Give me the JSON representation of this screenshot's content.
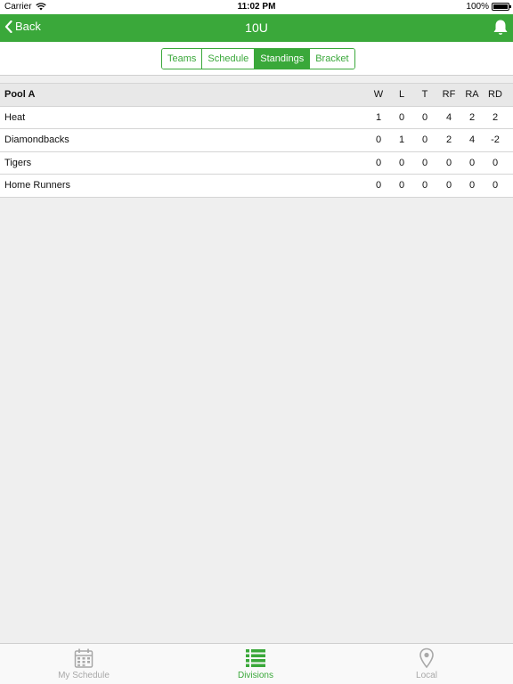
{
  "status": {
    "carrier": "Carrier",
    "time": "11:02 PM",
    "battery": "100%"
  },
  "nav": {
    "back_label": "Back",
    "title": "10U"
  },
  "segments": [
    {
      "label": "Teams",
      "active": false
    },
    {
      "label": "Schedule",
      "active": false
    },
    {
      "label": "Standings",
      "active": true
    },
    {
      "label": "Bracket",
      "active": false
    }
  ],
  "standings": {
    "pool_label": "Pool A",
    "columns": [
      "W",
      "L",
      "T",
      "RF",
      "RA",
      "RD"
    ],
    "rows": [
      {
        "team": "Heat",
        "stats": [
          "1",
          "0",
          "0",
          "4",
          "2",
          "2"
        ]
      },
      {
        "team": "Diamondbacks",
        "stats": [
          "0",
          "1",
          "0",
          "2",
          "4",
          "-2"
        ]
      },
      {
        "team": "Tigers",
        "stats": [
          "0",
          "0",
          "0",
          "0",
          "0",
          "0"
        ]
      },
      {
        "team": "Home Runners",
        "stats": [
          "0",
          "0",
          "0",
          "0",
          "0",
          "0"
        ]
      }
    ]
  },
  "tabs": [
    {
      "label": "My Schedule",
      "icon": "calendar-icon",
      "active": false
    },
    {
      "label": "Divisions",
      "icon": "list-icon",
      "active": true
    },
    {
      "label": "Local",
      "icon": "location-pin-icon",
      "active": false
    }
  ],
  "colors": {
    "accent": "#3aa83a",
    "inactive": "#a8a8a8",
    "background": "#efefef"
  }
}
